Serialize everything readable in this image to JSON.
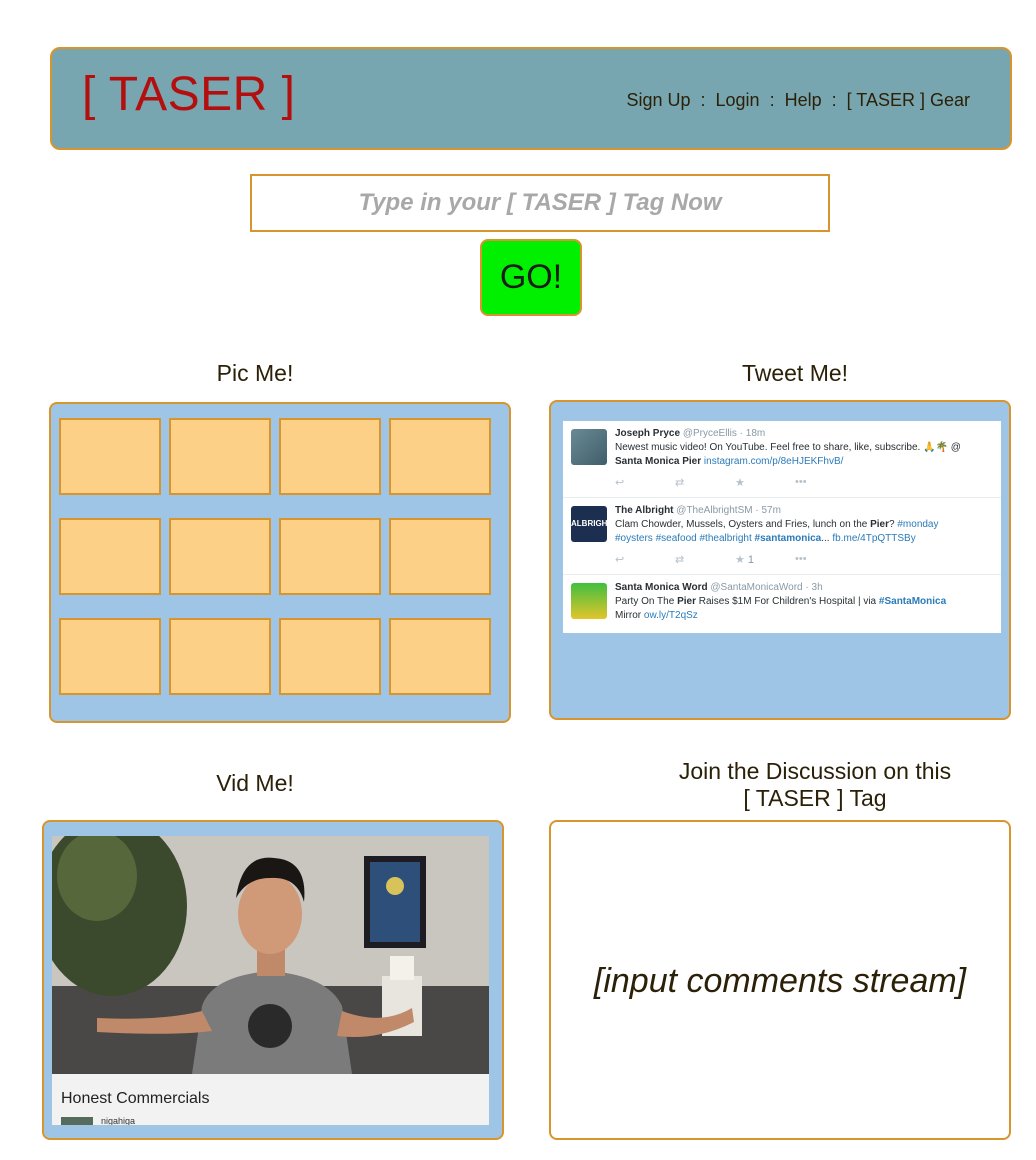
{
  "header": {
    "logo": "[ TASER ]",
    "nav": {
      "signup": "Sign Up",
      "login": "Login",
      "help": "Help",
      "gear": "[ TASER ] Gear",
      "separator": ":"
    }
  },
  "search": {
    "placeholder": "Type in your [ TASER ] Tag Now",
    "go_label": "GO!"
  },
  "sections": {
    "pic": "Pic Me!",
    "tweet": "Tweet Me!",
    "vid": "Vid Me!",
    "discussion_line1": "Join the Discussion on this",
    "discussion_line2": "[ TASER ] Tag"
  },
  "tweets": [
    {
      "name": "Joseph Pryce",
      "handle": "@PryceEllis",
      "time": "· 18m",
      "text": "Newest music video! On YouTube. Feel free to share, like, subscribe. 🙏🌴 @",
      "text2_bold": "Santa Monica Pier",
      "text2_link": "instagram.com/p/8eHJEKFhvB/"
    },
    {
      "name": "The Albright",
      "handle": "@TheAlbrightSM",
      "time": "· 57m",
      "text": "Clam Chowder, Mussels, Oysters and Fries, lunch on the",
      "text_bold": "Pier",
      "text_after": "?",
      "hashtag1": "#monday",
      "hashtags2": "#oysters #seafood #thealbright",
      "hashtag_bold": "#santamonica",
      "ellipsis": "...",
      "link": "fb.me/4TpQTTSBy",
      "fav_count": "1"
    },
    {
      "name": "Santa Monica Word",
      "handle": "@SantaMonicaWord",
      "time": "· 3h",
      "text": "Party On The",
      "text_bold": "Pier",
      "text_after": "Raises $1M For Children's Hospital | via",
      "hashtag_bold": "#SantaMonica",
      "text3": "Mirror",
      "link": "ow.ly/T2qSz"
    }
  ],
  "video": {
    "title": "Honest Commercials",
    "channel": "nigahiga"
  },
  "comments": {
    "placeholder": "[input comments stream]"
  },
  "icons": {
    "reply": "reply-icon",
    "retweet": "retweet-icon",
    "favorite": "star-icon",
    "more": "more-icon"
  },
  "colors": {
    "header_bg": "#77a6b0",
    "border": "#d8952e",
    "logo": "#b30f0f",
    "go_button": "#00f000",
    "panel_bg": "#9fc5e6",
    "pic_tile": "#fcd086"
  }
}
